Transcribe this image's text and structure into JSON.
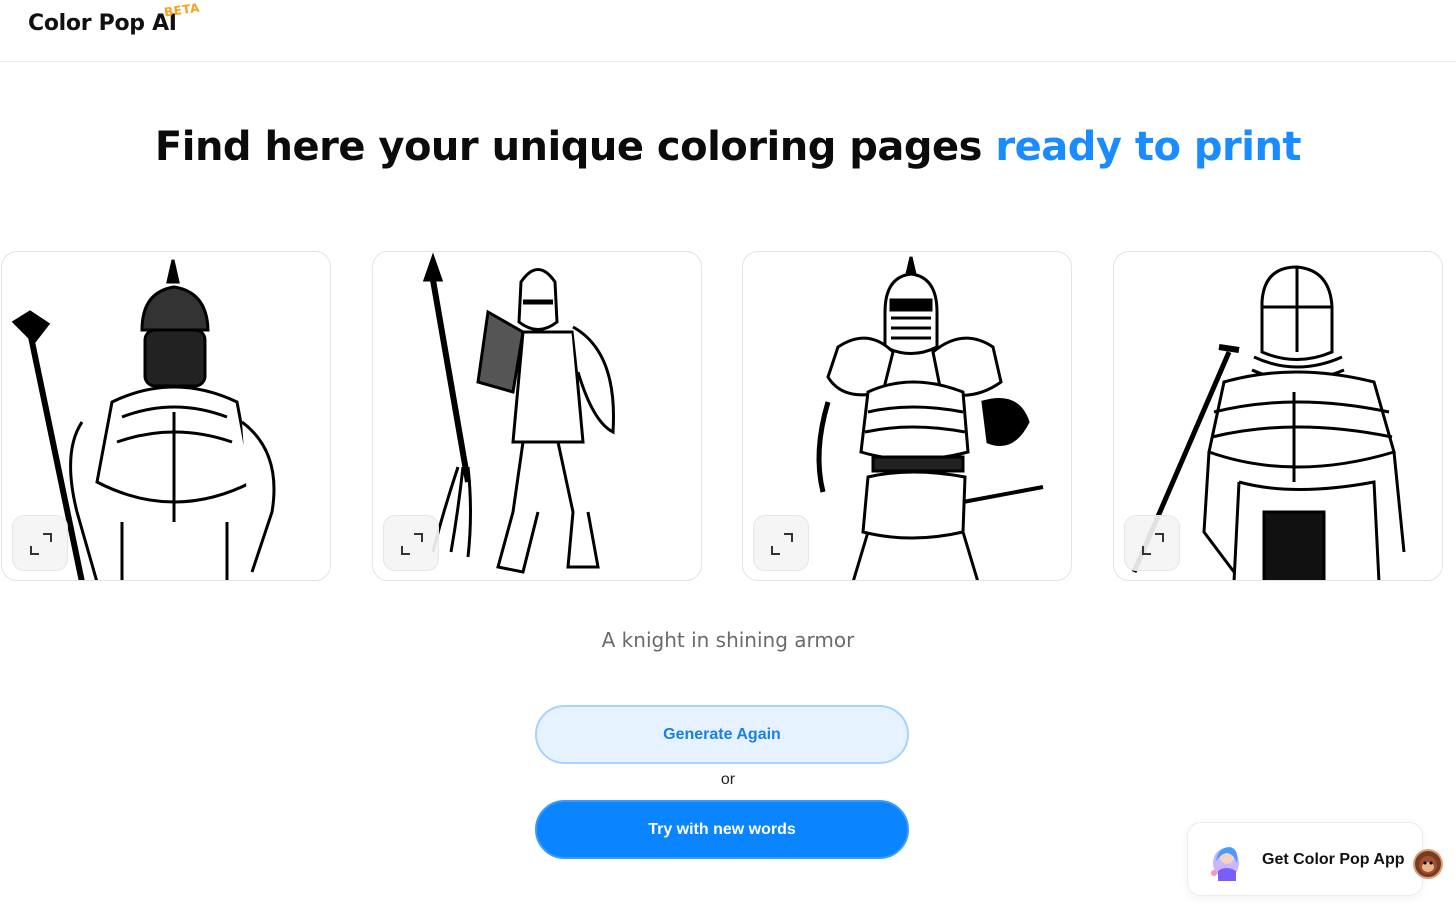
{
  "header": {
    "logo_text": "Color Pop AI",
    "beta_badge": "BETA"
  },
  "main": {
    "headline_main": "Find here your unique coloring pages ",
    "headline_accent": "ready to print",
    "accent_color": "#1a8cff",
    "gallery": [
      {
        "icon": "knight-helmet-mace-illustration"
      },
      {
        "icon": "knight-spear-shield-illustration"
      },
      {
        "icon": "knight-visor-sword-illustration"
      },
      {
        "icon": "knight-great-helm-sword-illustration"
      }
    ],
    "prompt_text": "A knight in shining armor",
    "generate_again_label": "Generate Again",
    "or_text": "or",
    "try_new_words_label": "Try with new words",
    "primary_color": "#0a84ff"
  },
  "promo": {
    "get_app_label": "Get Color Pop App"
  }
}
